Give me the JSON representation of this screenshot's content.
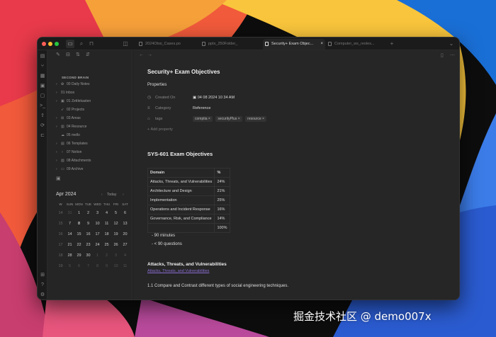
{
  "tabs": [
    {
      "label": "2024Obsi_Cases.po",
      "active": false
    },
    {
      "label": "pptx_250Folder_",
      "active": false
    },
    {
      "label": "Security+ Exam Objec...",
      "active": true
    },
    {
      "label": "Computer_ws_reoles...",
      "active": false
    }
  ],
  "sidebar": {
    "vault_name": "SECOND BRAIN",
    "folders": [
      {
        "label": "00 Daily Notes"
      },
      {
        "label": "01 Inbox"
      },
      {
        "label": "01 Zettlekasten"
      },
      {
        "label": "02 Projects"
      },
      {
        "label": "03 Areas"
      },
      {
        "label": "04 Resource"
      },
      {
        "label": "05 mello"
      },
      {
        "label": "06 Templates"
      },
      {
        "label": "07 Notion"
      },
      {
        "label": "08 Attachments"
      },
      {
        "label": "09 Archive"
      }
    ]
  },
  "calendar": {
    "month": "Apr 2024",
    "today_label": "Today",
    "headers": [
      "W",
      "SUN",
      "MON",
      "TUE",
      "WED",
      "THU",
      "FRI",
      "SAT"
    ],
    "rows": [
      [
        "14",
        "31",
        "1",
        "2",
        "3",
        "4",
        "5",
        "6"
      ],
      [
        "15",
        "7",
        "8",
        "9",
        "10",
        "11",
        "12",
        "13"
      ],
      [
        "16",
        "14",
        "15",
        "16",
        "17",
        "18",
        "19",
        "20"
      ],
      [
        "17",
        "21",
        "22",
        "23",
        "24",
        "25",
        "26",
        "27"
      ],
      [
        "18",
        "28",
        "29",
        "30",
        "1",
        "2",
        "3",
        "4"
      ],
      [
        "19",
        "5",
        "6",
        "7",
        "8",
        "9",
        "10",
        "11"
      ]
    ]
  },
  "note": {
    "title": "Security+ Exam Objectives",
    "properties_label": "Properties",
    "properties": [
      {
        "key": "Created On",
        "value": "04 08 2024  10 34 AM",
        "icon": "clock-icon"
      },
      {
        "key": "Category",
        "value": "Reference",
        "icon": "list-icon"
      },
      {
        "key": "tags",
        "value": "",
        "icon": "tag-icon"
      }
    ],
    "tags": [
      "comptia",
      "securityPlus",
      "resource"
    ],
    "add_property": "Add property",
    "heading": "SYS-601 Exam Objectives",
    "table": {
      "headers": [
        "Domain",
        "%"
      ],
      "rows": [
        [
          "Attacks, Threats, and Vulnerabilities",
          "24%"
        ],
        [
          "Architecture and Design",
          "21%"
        ],
        [
          "Implementation",
          "25%"
        ],
        [
          "Operations and Incident Response",
          "16%"
        ],
        [
          "Governance, Risk, and Compliance",
          "14%"
        ],
        [
          "",
          "100%"
        ]
      ]
    },
    "bullets": [
      "90 minutes",
      "< 90 questions"
    ],
    "section_heading": "Attacks, Threats, and Vulnerabilities",
    "section_link": "Attacks, Threats, and Vulnerabilities",
    "paragraph": "1.1 Compare and Contrast different types of social engineering techniques."
  },
  "watermark": "掘金技术社区 @ demo007x",
  "colors": {
    "accent": "#8a6bd1",
    "close": "#ff5f57",
    "minimize": "#febc2e",
    "zoom": "#28c840"
  }
}
